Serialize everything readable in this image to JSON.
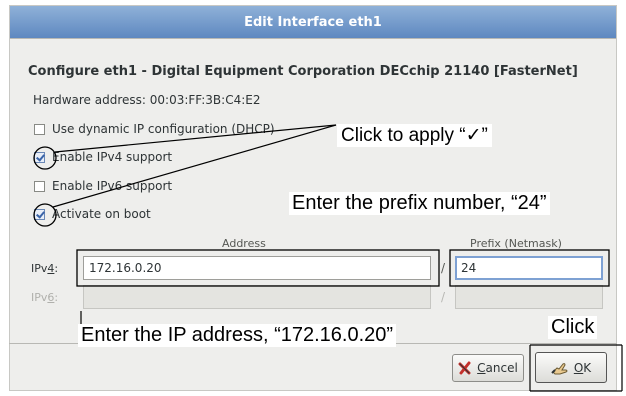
{
  "window": {
    "title": "Edit Interface eth1"
  },
  "device": {
    "heading": "Configure eth1 - Digital Equipment Corporation DECchip 21140 [FasterNet]",
    "hardware_address": "Hardware address: 00:03:FF:3B:C4:E2"
  },
  "options": [
    {
      "label": "Use dynamic IP configuration (DHCP)",
      "checked": false
    },
    {
      "label": "Enable IPv4 support",
      "checked": true
    },
    {
      "label": "Enable IPv6 support",
      "checked": false
    },
    {
      "label": "Activate on boot",
      "checked": true
    }
  ],
  "columns": {
    "address": "Address",
    "prefix": "Prefix (Netmask)"
  },
  "ipv4": {
    "label": "IPv4:",
    "address": "172.16.0.20",
    "separator": "/",
    "prefix": "24"
  },
  "ipv6": {
    "label": "IPv6:",
    "address": "",
    "separator": "/",
    "prefix": ""
  },
  "buttons": {
    "cancel": {
      "label": "Cancel",
      "icon": "cancel-x-icon"
    },
    "ok": {
      "label": "OK",
      "icon": "ok-hand-icon"
    }
  },
  "annotations": {
    "click_apply": "Click to apply “✓”",
    "enter_prefix": "Enter the prefix number, “24”",
    "enter_ip": "Enter the IP address, “172.16.0.20”",
    "click": "Click"
  },
  "colors": {
    "title_bar": "#6f96c9",
    "dialog_bg": "#eeeeec",
    "focus_ring": "#7ea1d3",
    "annotation": "#000000"
  }
}
